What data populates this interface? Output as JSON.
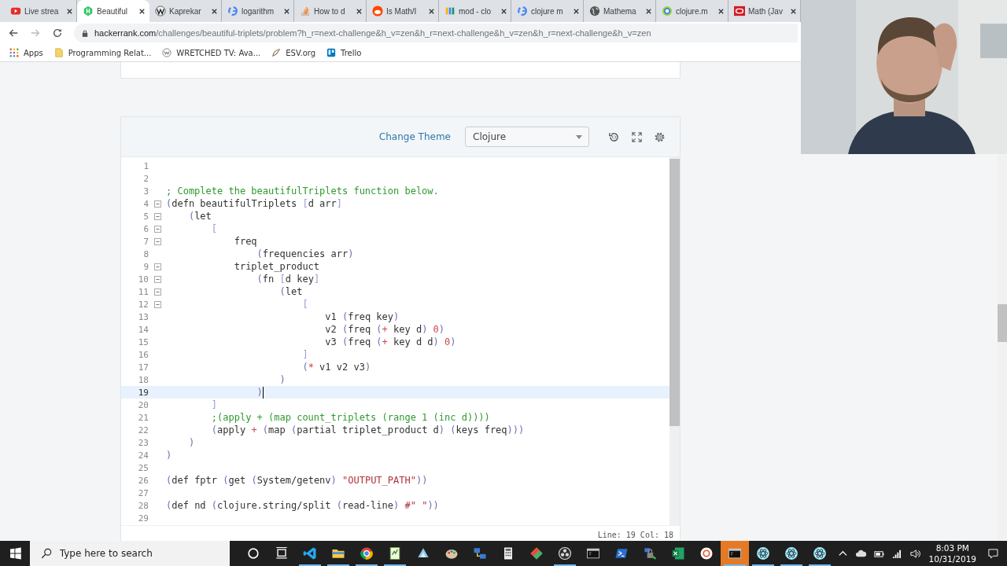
{
  "tabs": [
    {
      "kind": "youtube",
      "title": "Live strea",
      "selected": false
    },
    {
      "kind": "hackerrank",
      "title": "Beautiful",
      "selected": true
    },
    {
      "kind": "wiki",
      "title": "Kaprekar",
      "selected": false
    },
    {
      "kind": "google",
      "title": "logarithm",
      "selected": false
    },
    {
      "kind": "stack",
      "title": "How to d",
      "selected": false
    },
    {
      "kind": "reddit",
      "title": "Is Math/I",
      "selected": false
    },
    {
      "kind": "bars",
      "title": "mod - clo",
      "selected": false
    },
    {
      "kind": "google",
      "title": "clojure m",
      "selected": false
    },
    {
      "kind": "globe",
      "title": "Mathema",
      "selected": false
    },
    {
      "kind": "clojure",
      "title": "clojure.m",
      "selected": false
    },
    {
      "kind": "oracle",
      "title": "Math (Jav",
      "selected": false
    }
  ],
  "address": {
    "domain": "hackerrank.com",
    "path": "/challenges/beautiful-triplets/problem?h_r=next-challenge&h_v=zen&h_r=next-challenge&h_v=zen&h_r=next-challenge&h_v=zen"
  },
  "bookmarks": [
    {
      "kind": "apps",
      "label": "Apps"
    },
    {
      "kind": "folder",
      "label": "Programming Relat..."
    },
    {
      "kind": "w",
      "label": "WRETCHED TV: Ava..."
    },
    {
      "kind": "esv",
      "label": "ESV.org"
    },
    {
      "kind": "trello",
      "label": "Trello"
    }
  ],
  "editor": {
    "change_theme": "Change Theme",
    "language": "Clojure",
    "status": "Line: 19 Col: 18",
    "lines": [
      {
        "n": "1",
        "fold": false,
        "current": false
      },
      {
        "n": "2",
        "fold": false,
        "current": false
      },
      {
        "n": "3",
        "fold": false,
        "current": false,
        "segs": [
          {
            "kind": "comment",
            "text": "; Complete the beautifulTriplets function below."
          }
        ]
      },
      {
        "n": "4",
        "fold": true,
        "current": false,
        "segs": [
          {
            "kind": "paren",
            "text": "("
          },
          {
            "kind": "plain",
            "text": "defn beautifulTriplets "
          },
          {
            "kind": "bracket",
            "text": "["
          },
          {
            "kind": "plain",
            "text": "d arr"
          },
          {
            "kind": "bracket",
            "text": "]"
          }
        ]
      },
      {
        "n": "5",
        "fold": true,
        "current": false,
        "segs": [
          {
            "kind": "paren",
            "text": "    ("
          },
          {
            "kind": "plain",
            "text": "let"
          }
        ]
      },
      {
        "n": "6",
        "fold": true,
        "current": false,
        "segs": [
          {
            "kind": "bracket",
            "text": "        ["
          }
        ]
      },
      {
        "n": "7",
        "fold": true,
        "current": false,
        "segs": [
          {
            "kind": "plain",
            "text": "            freq"
          }
        ]
      },
      {
        "n": "8",
        "fold": false,
        "current": false,
        "segs": [
          {
            "kind": "paren",
            "text": "                ("
          },
          {
            "kind": "plain",
            "text": "frequencies arr"
          },
          {
            "kind": "paren",
            "text": ")"
          }
        ]
      },
      {
        "n": "9",
        "fold": true,
        "current": false,
        "segs": [
          {
            "kind": "plain",
            "text": "            triplet_product"
          }
        ]
      },
      {
        "n": "10",
        "fold": true,
        "current": false,
        "segs": [
          {
            "kind": "paren",
            "text": "                ("
          },
          {
            "kind": "plain",
            "text": "fn "
          },
          {
            "kind": "bracket",
            "text": "["
          },
          {
            "kind": "plain",
            "text": "d key"
          },
          {
            "kind": "bracket",
            "text": "]"
          }
        ]
      },
      {
        "n": "11",
        "fold": true,
        "current": false,
        "segs": [
          {
            "kind": "paren",
            "text": "                    ("
          },
          {
            "kind": "plain",
            "text": "let"
          }
        ]
      },
      {
        "n": "12",
        "fold": true,
        "current": false,
        "segs": [
          {
            "kind": "bracket",
            "text": "                        ["
          }
        ]
      },
      {
        "n": "13",
        "fold": false,
        "current": false,
        "segs": [
          {
            "kind": "plain",
            "text": "                            v1 "
          },
          {
            "kind": "paren",
            "text": "("
          },
          {
            "kind": "plain",
            "text": "freq key"
          },
          {
            "kind": "paren",
            "text": ")"
          }
        ]
      },
      {
        "n": "14",
        "fold": false,
        "current": false,
        "segs": [
          {
            "kind": "plain",
            "text": "                            v2 "
          },
          {
            "kind": "paren",
            "text": "("
          },
          {
            "kind": "plain",
            "text": "freq "
          },
          {
            "kind": "paren",
            "text": "("
          },
          {
            "kind": "operator",
            "text": "+"
          },
          {
            "kind": "plain",
            "text": " key d"
          },
          {
            "kind": "paren",
            "text": ") "
          },
          {
            "kind": "operator",
            "text": "0"
          },
          {
            "kind": "paren",
            "text": ")"
          }
        ]
      },
      {
        "n": "15",
        "fold": false,
        "current": false,
        "segs": [
          {
            "kind": "plain",
            "text": "                            v3 "
          },
          {
            "kind": "paren",
            "text": "("
          },
          {
            "kind": "plain",
            "text": "freq "
          },
          {
            "kind": "paren",
            "text": "("
          },
          {
            "kind": "operator",
            "text": "+"
          },
          {
            "kind": "plain",
            "text": " key d d"
          },
          {
            "kind": "paren",
            "text": ") "
          },
          {
            "kind": "operator",
            "text": "0"
          },
          {
            "kind": "paren",
            "text": ")"
          }
        ]
      },
      {
        "n": "16",
        "fold": false,
        "current": false,
        "segs": [
          {
            "kind": "bracket",
            "text": "                        ]"
          }
        ]
      },
      {
        "n": "17",
        "fold": false,
        "current": false,
        "segs": [
          {
            "kind": "paren",
            "text": "                        ("
          },
          {
            "kind": "operator",
            "text": "*"
          },
          {
            "kind": "plain",
            "text": " v1 v2 v3"
          },
          {
            "kind": "paren",
            "text": ")"
          }
        ]
      },
      {
        "n": "18",
        "fold": false,
        "current": false,
        "segs": [
          {
            "kind": "paren",
            "text": "                    )"
          }
        ]
      },
      {
        "n": "19",
        "fold": false,
        "current": true,
        "segs": [
          {
            "kind": "paren",
            "text": "                )"
          }
        ]
      },
      {
        "n": "20",
        "fold": false,
        "current": false,
        "segs": [
          {
            "kind": "bracket",
            "text": "        ]"
          }
        ]
      },
      {
        "n": "21",
        "fold": false,
        "current": false,
        "segs": [
          {
            "kind": "comment",
            "text": "        ;(apply + (map count_triplets (range 1 (inc d))))"
          }
        ]
      },
      {
        "n": "22",
        "fold": false,
        "current": false,
        "segs": [
          {
            "kind": "paren",
            "text": "        ("
          },
          {
            "kind": "plain",
            "text": "apply "
          },
          {
            "kind": "operator",
            "text": "+ "
          },
          {
            "kind": "paren",
            "text": "("
          },
          {
            "kind": "plain",
            "text": "map "
          },
          {
            "kind": "paren",
            "text": "("
          },
          {
            "kind": "plain",
            "text": "partial triplet_product d"
          },
          {
            "kind": "paren",
            "text": ") ("
          },
          {
            "kind": "plain",
            "text": "keys freq"
          },
          {
            "kind": "paren",
            "text": ")))"
          }
        ]
      },
      {
        "n": "23",
        "fold": false,
        "current": false,
        "segs": [
          {
            "kind": "paren",
            "text": "    )"
          }
        ]
      },
      {
        "n": "24",
        "fold": false,
        "current": false,
        "segs": [
          {
            "kind": "paren",
            "text": ")"
          }
        ]
      },
      {
        "n": "25",
        "fold": false,
        "current": false
      },
      {
        "n": "26",
        "fold": false,
        "current": false,
        "segs": [
          {
            "kind": "paren",
            "text": "("
          },
          {
            "kind": "plain",
            "text": "def fptr "
          },
          {
            "kind": "paren",
            "text": "("
          },
          {
            "kind": "plain",
            "text": "get "
          },
          {
            "kind": "paren",
            "text": "("
          },
          {
            "kind": "plain",
            "text": "System/getenv"
          },
          {
            "kind": "paren",
            "text": ") "
          },
          {
            "kind": "string",
            "text": "\"OUTPUT_PATH\""
          },
          {
            "kind": "paren",
            "text": "))"
          }
        ]
      },
      {
        "n": "27",
        "fold": false,
        "current": false
      },
      {
        "n": "28",
        "fold": false,
        "current": false,
        "segs": [
          {
            "kind": "paren",
            "text": "("
          },
          {
            "kind": "plain",
            "text": "def nd "
          },
          {
            "kind": "paren",
            "text": "("
          },
          {
            "kind": "plain",
            "text": "clojure.string/split "
          },
          {
            "kind": "paren",
            "text": "("
          },
          {
            "kind": "plain",
            "text": "read-line"
          },
          {
            "kind": "paren",
            "text": ") "
          },
          {
            "kind": "string",
            "text": "#\" \""
          },
          {
            "kind": "paren",
            "text": "))"
          }
        ]
      },
      {
        "n": "29",
        "fold": false,
        "current": false
      }
    ]
  },
  "taskbar": {
    "search_placeholder": "Type here to search",
    "apps": [
      {
        "kind": "cortana",
        "running": false,
        "flashing": false
      },
      {
        "kind": "taskview",
        "running": false,
        "flashing": false
      },
      {
        "kind": "vscode",
        "running": true,
        "flashing": false
      },
      {
        "kind": "explorer",
        "running": true,
        "flashing": false
      },
      {
        "kind": "chrome",
        "running": true,
        "flashing": false
      },
      {
        "kind": "notepad",
        "running": true,
        "flashing": false
      },
      {
        "kind": "pad",
        "running": false,
        "flashing": false
      },
      {
        "kind": "paint",
        "running": false,
        "flashing": false
      },
      {
        "kind": "network",
        "running": false,
        "flashing": false
      },
      {
        "kind": "calculator",
        "running": false,
        "flashing": false
      },
      {
        "kind": "diamond",
        "running": false,
        "flashing": false
      },
      {
        "kind": "obs",
        "running": true,
        "flashing": false
      },
      {
        "kind": "terminal",
        "running": false,
        "flashing": false
      },
      {
        "kind": "powershell",
        "running": false,
        "flashing": false
      },
      {
        "kind": "vpn",
        "running": false,
        "flashing": false
      },
      {
        "kind": "excel",
        "running": false,
        "flashing": false
      },
      {
        "kind": "ubuntu",
        "running": false,
        "flashing": false
      },
      {
        "kind": "terminal",
        "running": true,
        "flashing": true
      },
      {
        "kind": "electron",
        "running": true,
        "flashing": false
      },
      {
        "kind": "electron",
        "running": true,
        "flashing": false
      },
      {
        "kind": "electron",
        "running": true,
        "flashing": false
      }
    ],
    "time": "8:03 PM",
    "date": "10/31/2019"
  }
}
